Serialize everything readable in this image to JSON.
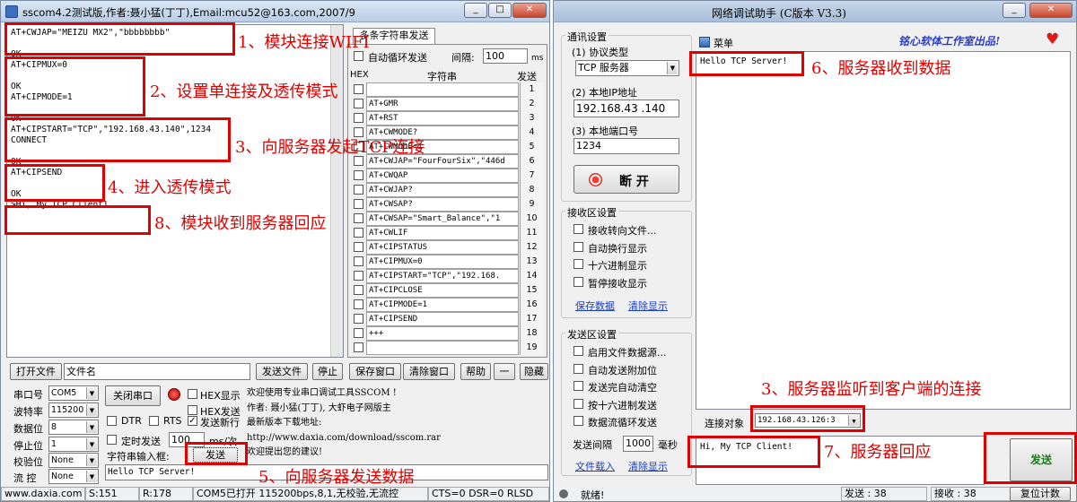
{
  "sscom": {
    "title": "sscom4.2测试版,作者:聂小猛(丁丁),Email:mcu52@163.com,2007/9",
    "terminal_lines": [
      "AT+CWJAP=\"MEIZU MX2\",\"bbbbbbbb\"",
      "",
      "OK",
      "AT+CIPMUX=0",
      "",
      "OK",
      "AT+CIPMODE=1",
      "",
      "OK",
      "AT+CIPSTART=\"TCP\",\"192.168.43.140\",1234",
      "CONNECT",
      "",
      "OK",
      "AT+CIPSEND",
      "",
      "OK",
      ">Hi, My TCP Client!"
    ],
    "tab_label": "多条字符串发送",
    "loop_send_label": "自动循环发送",
    "interval_label": "间隔:",
    "interval_value": "100",
    "interval_unit": "ms",
    "col_hex": "HEX",
    "col_string": "字符串",
    "col_send": "发送",
    "multi_rows": [
      {
        "text": "",
        "n": "1"
      },
      {
        "text": "AT+GMR",
        "n": "2"
      },
      {
        "text": "AT+RST",
        "n": "3"
      },
      {
        "text": "AT+CWMODE?",
        "n": "4"
      },
      {
        "text": "AT+CWMODE=1",
        "n": "5"
      },
      {
        "text": "AT+CWJAP=\"FourFourSix\",\"446d",
        "n": "6"
      },
      {
        "text": "AT+CWQAP",
        "n": "7"
      },
      {
        "text": "AT+CWJAP?",
        "n": "8"
      },
      {
        "text": "AT+CWSAP?",
        "n": "9"
      },
      {
        "text": "AT+CWSAP=\"Smart_Balance\",\"1",
        "n": "10"
      },
      {
        "text": "AT+CWLIF",
        "n": "11"
      },
      {
        "text": "AT+CIPSTATUS",
        "n": "12"
      },
      {
        "text": "AT+CIPMUX=0",
        "n": "13"
      },
      {
        "text": "AT+CIPSTART=\"TCP\",\"192.168.",
        "n": "14"
      },
      {
        "text": "AT+CIPCLOSE",
        "n": "15"
      },
      {
        "text": "AT+CIPMODE=1",
        "n": "16"
      },
      {
        "text": "AT+CIPSEND",
        "n": "17"
      },
      {
        "text": "+++",
        "n": "18"
      },
      {
        "text": "",
        "n": "19"
      }
    ],
    "open_file": "打开文件",
    "file_name": "文件名",
    "send_file": "发送文件",
    "stop": "停止",
    "save_window": "保存窗口",
    "clear_window": "清除窗口",
    "help": "帮助",
    "minus": "一",
    "hide": "隐藏",
    "port_label": "串口号",
    "port_value": "COM5",
    "baud_label": "波特率",
    "baud_value": "115200",
    "databits_label": "数据位",
    "databits_value": "8",
    "stopbits_label": "停止位",
    "stopbits_value": "1",
    "parity_label": "校验位",
    "parity_value": "None",
    "flow_label": "流 控",
    "flow_value": "None",
    "close_port": "关闭串口",
    "hex_display": "HEX显示",
    "hex_send": "HEX发送",
    "dtr": "DTR",
    "rts": "RTS",
    "send_newline": "发送新行",
    "timed_send": "定时发送",
    "timed_value": "100",
    "timed_unit": "ms/次",
    "input_label": "字符串输入框:",
    "send_btn": "发送",
    "input_value": "Hello TCP Server!",
    "info_lines": [
      "欢迎使用专业串口调试工具SSCOM !",
      "作者: 聂小猛(丁丁), 大虾电子网版主",
      "最新版本下载地址:",
      "http://www.daxia.com/download/sscom.rar",
      "欢迎提出您的建议!"
    ],
    "status": [
      "www.daxia.com",
      "S:151",
      "R:178",
      "COM5已打开  115200bps,8,1,无校验,无流控",
      "CTS=0 DSR=0 RLSD"
    ]
  },
  "netassist": {
    "title": "网络调试助手 (C版本 V3.3)",
    "brand": "铭心软体工作室出品!",
    "comm_settings": "通讯设置",
    "protocol_label": "(1) 协议类型",
    "protocol_value": "TCP 服务器",
    "ip_label": "(2) 本地IP地址",
    "ip_value": "192.168.43 .140",
    "port_label": "(3) 本地端口号",
    "port_value": "1234",
    "disconnect": "断 开",
    "recv_settings": "接收区设置",
    "recv_opts": [
      "接收转向文件...",
      "自动换行显示",
      "十六进制显示",
      "暂停接收显示"
    ],
    "save_data": "保存数据",
    "clear_display": "清除显示",
    "send_settings": "发送区设置",
    "send_opts": [
      "启用文件数据源...",
      "自动发送附加位",
      "发送完自动清空",
      "按十六进制发送",
      "数据流循环发送"
    ],
    "send_interval_label": "发送间隔",
    "send_interval_value": "1000",
    "send_interval_unit": "毫秒",
    "load_file": "文件载入",
    "clear_display2": "清除显示",
    "menu": "菜单",
    "received_text": "Hello TCP Server!",
    "conn_label": "连接对象",
    "conn_value": "192.168.43.126:3",
    "send_text": "Hi, My TCP Client!",
    "send_btn": "发送",
    "status_ready": "就绪!",
    "sent_label": "发送 : 38",
    "recv_label": "接收 : 38",
    "reset_count": "复位计数"
  },
  "annotations": {
    "a1": "1、模块连接WIFI",
    "a2": "2、设置单连接及透传模式",
    "a3": "3、向服务器发起TCP连接",
    "a4": "4、进入透传模式",
    "a5": "5、向服务器发送数据",
    "a6": "6、服务器收到数据",
    "a7": "7、服务器回应",
    "a8": "8、模块收到服务器回应",
    "a9": "3、服务器监听到客户端的连接"
  },
  "colors": {
    "annotation_red": "#e00000",
    "link_blue": "#1a3db8",
    "send_green": "#1a7a1a"
  }
}
